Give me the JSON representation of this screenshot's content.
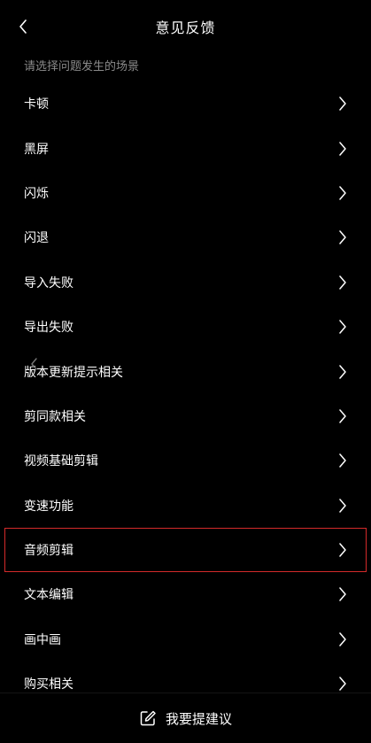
{
  "header": {
    "title": "意见反馈",
    "back_icon": "chevron-left-icon"
  },
  "hint": "请选择问题发生的场景",
  "items": [
    {
      "label": "卡顿"
    },
    {
      "label": "黑屏"
    },
    {
      "label": "闪烁"
    },
    {
      "label": "闪退"
    },
    {
      "label": "导入失败"
    },
    {
      "label": "导出失败"
    },
    {
      "label": "版本更新提示相关"
    },
    {
      "label": "剪同款相关"
    },
    {
      "label": "视频基础剪辑"
    },
    {
      "label": "变速功能"
    },
    {
      "label": "音频剪辑",
      "selected": true
    },
    {
      "label": "文本编辑"
    },
    {
      "label": "画中画"
    },
    {
      "label": "购买相关"
    }
  ],
  "footer": {
    "button_label": "我要提建议",
    "button_icon": "edit-icon"
  },
  "colors": {
    "background": "#000000",
    "text": "#ffffff",
    "hint": "#8a8a8a",
    "highlight": "#d42a2a"
  }
}
